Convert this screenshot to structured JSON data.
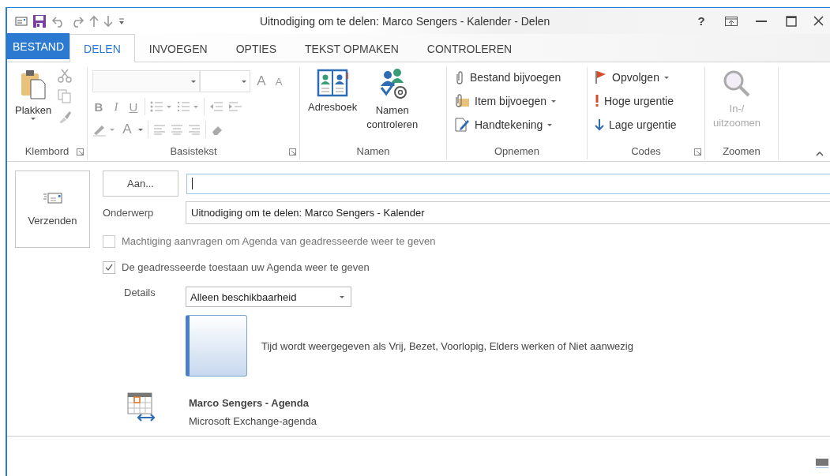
{
  "window": {
    "title": "Uitnodiging om te delen: Marco Sengers - Kalender - Delen",
    "help": "?"
  },
  "tabs": [
    {
      "label": "BESTAND",
      "kind": "file",
      "selected": false
    },
    {
      "label": "DELEN",
      "kind": "tab",
      "selected": true
    },
    {
      "label": "INVOEGEN",
      "kind": "tab",
      "selected": false
    },
    {
      "label": "OPTIES",
      "kind": "tab",
      "selected": false
    },
    {
      "label": "TEKST OPMAKEN",
      "kind": "tab",
      "selected": false
    },
    {
      "label": "CONTROLEREN",
      "kind": "tab",
      "selected": false
    }
  ],
  "ribbon": {
    "groups": [
      {
        "kind": "clipboard",
        "label": "Klembord",
        "launcher": true,
        "items": [
          {
            "label": "Plakken",
            "kind": "large",
            "dropdown": true,
            "disabled": false
          }
        ]
      },
      {
        "kind": "basic_text",
        "label": "Basistekst",
        "launcher": true,
        "disabled": true,
        "grow_shrink": [
          "A",
          "A"
        ],
        "format": [
          "B",
          "I",
          "U"
        ],
        "font_color": "A"
      },
      {
        "kind": "buttons",
        "label": "Namen",
        "launcher": false,
        "items": [
          {
            "label": "Adresboek",
            "kind": "large",
            "dropdown": false,
            "disabled": false
          },
          {
            "label": "Namen controleren",
            "kind": "large",
            "dropdown": false,
            "disabled": false
          }
        ]
      },
      {
        "kind": "buttons",
        "label": "Opnemen",
        "launcher": false,
        "items": [
          {
            "label": "Bestand bijvoegen",
            "kind": "small",
            "dropdown": false,
            "disabled": false
          },
          {
            "label": "Item bijvoegen",
            "kind": "small",
            "dropdown": true,
            "disabled": false
          },
          {
            "label": "Handtekening",
            "kind": "small",
            "dropdown": true,
            "disabled": false
          }
        ]
      },
      {
        "kind": "buttons",
        "label": "Codes",
        "launcher": true,
        "items": [
          {
            "label": "Opvolgen",
            "kind": "small",
            "dropdown": true,
            "disabled": false
          },
          {
            "label": "Hoge urgentie",
            "kind": "small",
            "dropdown": false,
            "disabled": false
          },
          {
            "label": "Lage urgentie",
            "kind": "small",
            "dropdown": false,
            "disabled": false
          }
        ]
      },
      {
        "kind": "buttons",
        "label": "Zoomen",
        "launcher": false,
        "items": [
          {
            "label": "In-/ uitzoomen",
            "kind": "large",
            "dropdown": false,
            "disabled": true
          }
        ]
      }
    ]
  },
  "form": {
    "send_button": "Verzenden",
    "to_button": "Aan...",
    "subject": {
      "label": "Onderwerp",
      "value": "Uitnodiging om te delen: Marco Sengers - Kalender"
    },
    "checkboxes": [
      {
        "label": "Machtiging aanvragen om Agenda van geadresseerde weer te geven",
        "checked": false,
        "disabled": true
      },
      {
        "label": "De geadresseerde toestaan uw Agenda weer te geven",
        "checked": true,
        "disabled": false
      }
    ],
    "details": {
      "label": "Details",
      "value": "Alleen beschikbaarheid"
    },
    "preview_text": "Tijd wordt weergegeven als Vrij, Bezet, Voorlopig, Elders werken of Niet aanwezig",
    "calendar": {
      "name": "Marco Sengers - Agenda",
      "type": "Microsoft Exchange-agenda"
    }
  }
}
